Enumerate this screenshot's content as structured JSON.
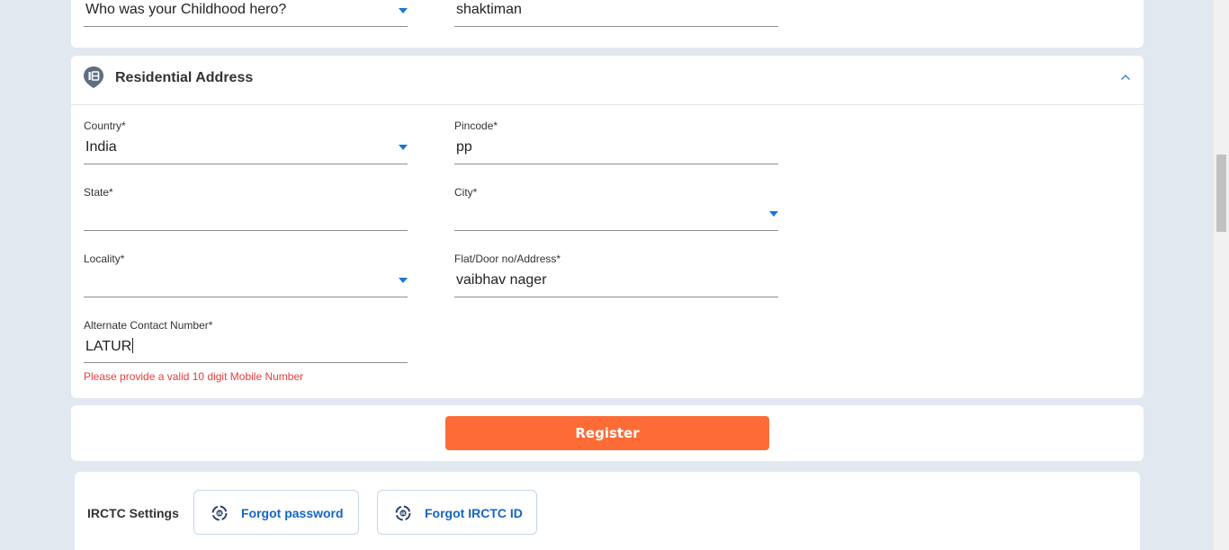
{
  "security": {
    "question_value": "Who was your Childhood hero?",
    "answer_value": "shaktiman"
  },
  "address": {
    "title": "Residential Address",
    "country": {
      "label": "Country*",
      "value": "India"
    },
    "pincode": {
      "label": "Pincode*",
      "value": "pp"
    },
    "state": {
      "label": "State*",
      "value": ""
    },
    "city": {
      "label": "City*",
      "value": ""
    },
    "locality": {
      "label": "Locality*",
      "value": ""
    },
    "flat": {
      "label": "Flat/Door no/Address*",
      "value": "vaibhav nager"
    },
    "alternate": {
      "label": "Alternate Contact Number*",
      "value": "LATUR"
    },
    "error": "Please provide a valid 10 digit Mobile Number"
  },
  "register": {
    "label": "Register"
  },
  "settings": {
    "title": "IRCTC Settings",
    "forgot_password": "Forgot password",
    "forgot_id": "Forgot IRCTC ID"
  },
  "colors": {
    "accent": "#1976d2",
    "register": "#fd6c36",
    "error": "#e53e3e",
    "link": "#1565c0",
    "background": "#e2e8f0"
  }
}
